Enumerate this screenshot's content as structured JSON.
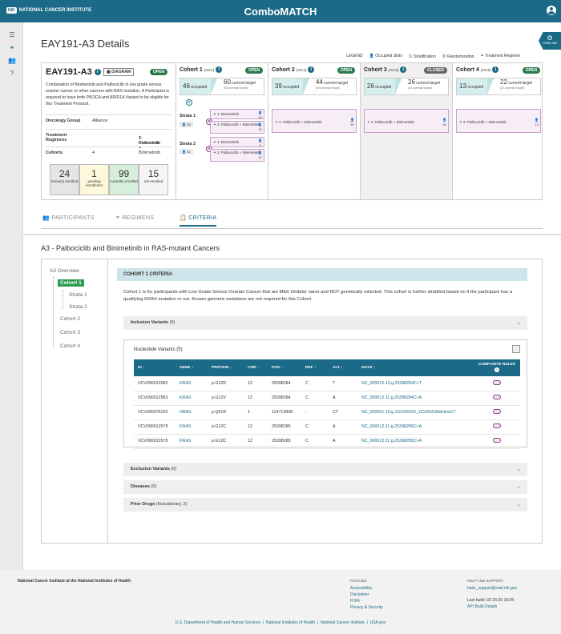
{
  "app": {
    "org": "NATIONAL CANCER INSTITUTE",
    "nih": "NIH",
    "title": "ComboMATCH"
  },
  "page": {
    "title": "EAY191-A3 Details",
    "timeline": "TIMELINE"
  },
  "legend": {
    "label": "LEGEND",
    "items": [
      "Occupied Slots",
      "Stratification",
      "Randomization",
      "Treatment Regimen"
    ]
  },
  "protocol": {
    "id": "EAY191-A3",
    "diagram": "DIAGRAM",
    "status": "OPEN",
    "description": "Combination of Binimetinib and Palbociclib in low grade serous ovarian cancer or other cancers with RAS mutation. A Participant is required to have both PIK3CA and ARID1A Variant to be eligible for this Treatment Protocol.",
    "rows": [
      {
        "k": "Oncology Group",
        "v": "Alliance"
      },
      {
        "k": "Treatment Regimens",
        "v": "1: Binimetinib",
        "v2": "2: Palbociclib + Binimetinib"
      },
      {
        "k": "Cohorts",
        "v": "4"
      }
    ],
    "stats": [
      {
        "n": "24",
        "l": "formerly enrolled",
        "bg": "#e5e5e5"
      },
      {
        "n": "1",
        "l": "pending enrollment",
        "bg": "#fdf8dc"
      },
      {
        "n": "99",
        "l": "currently enrolled",
        "bg": "#d7eedd"
      },
      {
        "n": "15",
        "l": "not enrolled",
        "bg": "#f5f5f5"
      }
    ]
  },
  "cohorts": [
    {
      "name": "Cohort 1",
      "code": "(A3-1)",
      "status": "OPEN",
      "occ": "46",
      "occ_label": "occupied",
      "target": "60",
      "target_label": "current target",
      "potential": "(60 potential target)",
      "strata": [
        {
          "name": "Strata 1",
          "count": "25",
          "regs": [
            {
              "t": "1: Binimetinib",
              "c": "13"
            },
            {
              "t": "2: Palbociclib + Binimetinib",
              "c": "12"
            }
          ]
        },
        {
          "name": "Strata 2",
          "count": "21",
          "regs": [
            {
              "t": "1: Binimetinib",
              "c": "9"
            },
            {
              "t": "2: Palbociclib + Binimetinib",
              "c": "12"
            }
          ]
        }
      ]
    },
    {
      "name": "Cohort 2",
      "code": "(A3-1)",
      "status": "OPEN",
      "occ": "39",
      "occ_label": "occupied",
      "target": "44",
      "target_label": "current target",
      "potential": "(60 potential target)",
      "reg": "2: Palbociclib + Binimetinib",
      "regc": "39"
    },
    {
      "name": "Cohort 3",
      "code": "(A3-2)",
      "status": "CLOSED",
      "occ": "26",
      "occ_label": "occupied",
      "target": "26",
      "target_label": "current target",
      "potential": "(26 potential target)",
      "reg": "2: Palbociclib + Binimetinib",
      "regc": "26"
    },
    {
      "name": "Cohort 4",
      "code": "(A3-2)",
      "status": "OPEN",
      "occ": "13",
      "occ_label": "occupied",
      "target": "22",
      "target_label": "current target",
      "potential": "(22 potential target)",
      "reg": "2: Palbociclib + Binimetinib",
      "regc": "13"
    }
  ],
  "tabs": [
    "PARTICIPANTS",
    "REGIMENS",
    "CRITERIA"
  ],
  "section": {
    "title": "A3 - Palbociclib and Binimetinib in RAS-mutant Cancers"
  },
  "nav": {
    "overview": "A3 Overview",
    "items": [
      "Cohort 1",
      "Strata 1",
      "Strata 2",
      "Cohort 2",
      "Cohort 3",
      "Cohort 4"
    ]
  },
  "criteria": {
    "header": "COHORT 1 CRITERIA",
    "text": "Cohort 1 is for participants with Low Grade Serous Ovarian Cancer that are MEK inhibitor naive and NOT genetically selected. This cohort is further stratified based on if the participant has a qualifying KRAS mutation or not. Known genomic mutations are not required for this Cohort.",
    "inclusion": {
      "label": "Inclusion Variants",
      "count": "(5)"
    },
    "nucleotide": {
      "label": "Nucleotide Variants (5)",
      "columns": [
        "ID",
        "GENE",
        "PROTEIN",
        "CHR",
        "POS",
        "REF",
        "ALT",
        "HGVS",
        "COMPOSITE RULES"
      ],
      "rows": [
        [
          "VCV000012582",
          "KRAS",
          "p.G12D",
          "12",
          "25398284",
          "C",
          "T",
          "NC_000012.12:g.25398284C>T"
        ],
        [
          "VCV000012583",
          "KRAS",
          "p.G12V",
          "12",
          "25398284",
          "C",
          "A",
          "NC_000012.11:g.25398284C>A"
        ],
        [
          "VCV000376220",
          "NRAS",
          "p.Q61R",
          "1",
          "114713908",
          "-",
          "CT",
          "NC_000001.10:g.115256529_115256530delinsCT"
        ],
        [
          "VCV000012578",
          "KRAS",
          "p.G12C",
          "12",
          "25398285",
          "C",
          "A",
          "NC_000012.11:g.25398285C>A"
        ],
        [
          "VCV000012578",
          "KRAS",
          "p.G12C",
          "12",
          "25398285",
          "C",
          "A",
          "NC_000012.11:g.25398285C>A"
        ]
      ]
    },
    "accordions": [
      {
        "label": "Exclusion Variants",
        "count": "(0)"
      },
      {
        "label": "Diseases",
        "count": "(0)"
      },
      {
        "label": "Prior Drugs",
        "count": "(Inclusionary, 2)"
      }
    ]
  },
  "footer": {
    "org": "National Cancer Institute at the National Institutes of Health",
    "policies": {
      "title": "POLICIES",
      "links": [
        "Accessibility",
        "Disclaimer",
        "FOIA",
        "Privacy & Security"
      ]
    },
    "help": {
      "title": "HELP AND SUPPORT",
      "email": "badc_support@mail.nih.gov",
      "build": "Last build: 02-26-20 16:05",
      "api": "API Build Details"
    },
    "bottom": [
      "U.S. Department of Health and Human Services",
      "National Institutes of Health",
      "National Cancer Institute",
      "USA.gov"
    ]
  }
}
